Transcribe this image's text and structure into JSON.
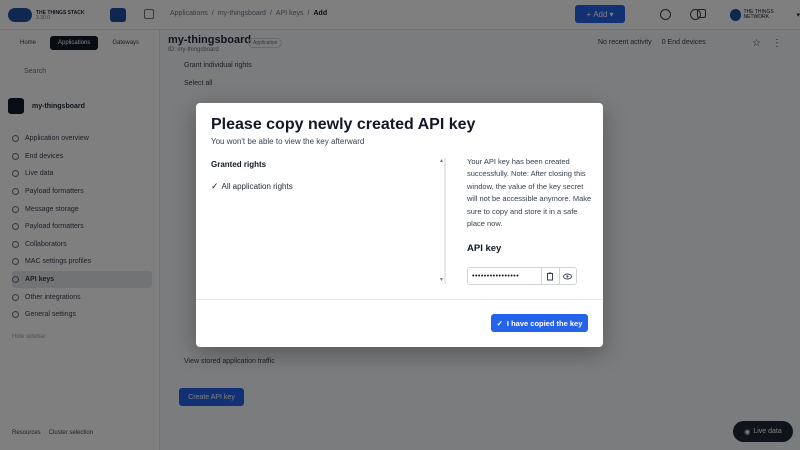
{
  "topbar": {
    "logo_name": "THE THINGS STACK",
    "logo_version": "3.30.0",
    "breadcrumb": [
      "Applications",
      "my-thingsboard",
      "API keys",
      "Add"
    ],
    "add_label": "Add",
    "user_name": "THE THINGS NETWORK"
  },
  "sidebar": {
    "tabs": [
      "Home",
      "Applications",
      "Gateways"
    ],
    "search_placeholder": "Search",
    "app_name": "my-thingsboard",
    "items": [
      "Application overview",
      "End devices",
      "Live data",
      "Payload formatters",
      "Message storage",
      "Payload formatters",
      "Collaborators",
      "MAC settings profiles",
      "API keys",
      "Other integrations",
      "General settings"
    ],
    "footer_hint": "Hide sidebar",
    "bottom_left": "Resources",
    "bottom_right": "Cluster selection"
  },
  "main": {
    "title": "my-thingsboard",
    "subtitle": "ID: my-thingsboard",
    "badge": "Application",
    "right_stats": [
      "No recent activity",
      "0 End devices"
    ],
    "lines": [
      "Grant individual rights",
      "Select all"
    ],
    "bottom_line": "View stored application traffic",
    "create_label": "Create API key"
  },
  "modal": {
    "title": "Please copy newly created API key",
    "subtitle": "You won't be able to view the key afterward",
    "rights_heading": "Granted rights",
    "rights": [
      "All application rights"
    ],
    "info": "Your API key has been created successfully. Note: After closing this window, the value of the key secret will not be accessible anymore. Make sure to copy and store it in a safe place now.",
    "key_heading": "API key",
    "key_masked": "••••••••••••••••",
    "confirm_label": "I have copied the key"
  },
  "live_chat_label": "Live data",
  "colors": {
    "accent": "#2563eb",
    "brand": "#1f4fa3",
    "overlay": "rgba(0,0,0,0.5)"
  }
}
